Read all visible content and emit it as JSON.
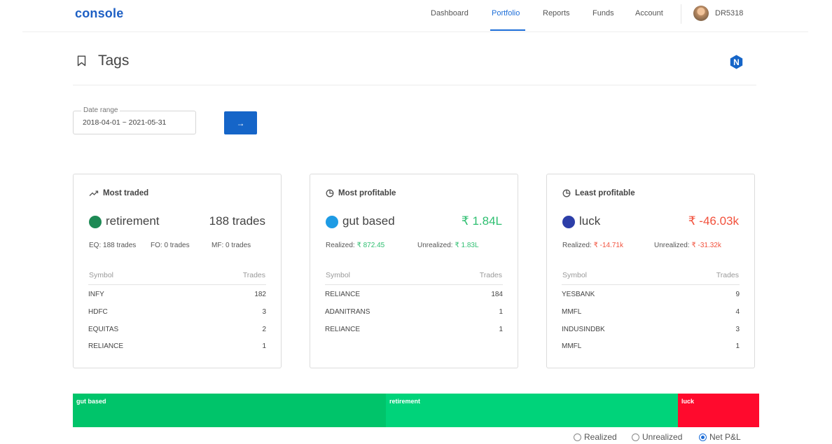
{
  "header": {
    "logo": "console",
    "nav": [
      "Dashboard",
      "Portfolio",
      "Reports",
      "Funds",
      "Account"
    ],
    "active_nav": "Portfolio",
    "user_id": "DR5318"
  },
  "page": {
    "title": "Tags",
    "badge_letter": "N"
  },
  "filter": {
    "label": "Date range",
    "value": "2018-04-01 ~ 2021-05-31",
    "submit_icon": "→"
  },
  "cards": [
    {
      "heading": "Most traded",
      "icon": "trending-up-icon",
      "tag": "retirement",
      "dot_color": "#1e8a55",
      "value": "188 trades",
      "value_tone": "neutral",
      "stats": [
        "EQ: 188 trades",
        "FO: 0 trades",
        "MF: 0 trades"
      ],
      "columns": [
        "Symbol",
        "Trades"
      ],
      "rows": [
        [
          "INFY",
          "182"
        ],
        [
          "HDFC",
          "3"
        ],
        [
          "EQUITAS",
          "2"
        ],
        [
          "RELIANCE",
          "1"
        ]
      ]
    },
    {
      "heading": "Most profitable",
      "icon": "pie-chart-icon",
      "tag": "gut based",
      "dot_color": "#1e9be4",
      "value": "₹ 1.84L",
      "value_tone": "pos",
      "stats_label_1": "Realized: ",
      "stats_value_1": "₹ 872.45",
      "stats_label_2": "Unrealized: ",
      "stats_value_2": "₹ 1.83L",
      "columns": [
        "Symbol",
        "Trades"
      ],
      "rows": [
        [
          "RELIANCE",
          "184"
        ],
        [
          "ADANITRANS",
          "1"
        ],
        [
          "RELIANCE",
          "1"
        ]
      ]
    },
    {
      "heading": "Least profitable",
      "icon": "pie-chart-icon",
      "tag": "luck",
      "dot_color": "#2c3ea8",
      "value": "₹ -46.03k",
      "value_tone": "neg",
      "stats_label_1": "Realized: ",
      "stats_value_1": "₹ -14.71k",
      "stats_label_2": "Unrealized: ",
      "stats_value_2": "₹ -31.32k",
      "columns": [
        "Symbol",
        "Trades"
      ],
      "rows": [
        [
          "YESBANK",
          "9"
        ],
        [
          "MMFL",
          "4"
        ],
        [
          "INDUSINDBK",
          "3"
        ],
        [
          "MMFL",
          "1"
        ]
      ]
    }
  ],
  "pnl_bar": {
    "segments": [
      {
        "label": "gut based",
        "color": "#00c46a",
        "share": 0.457
      },
      {
        "label": "retirement",
        "color": "#00d37a",
        "share": 0.427
      },
      {
        "label": "luck",
        "color": "#ff0a2d",
        "share": 0.116
      }
    ],
    "options": [
      "Realized",
      "Unrealized",
      "Net P&L"
    ],
    "selected": "Net P&L"
  }
}
